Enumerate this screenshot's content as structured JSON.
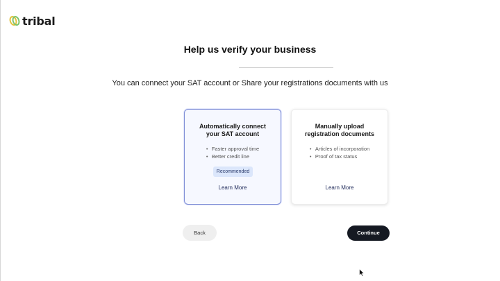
{
  "brand": {
    "name": "tribal"
  },
  "page": {
    "title": "Help us verify your business",
    "subtitle": "You can connect your SAT account or Share your registrations documents with us"
  },
  "cards": [
    {
      "title_line1": "Automatically connect",
      "title_line2": "your SAT account",
      "bullets": [
        "Faster approval time",
        "Better credit line"
      ],
      "badge": "Recommended",
      "link": "Learn More",
      "selected": true
    },
    {
      "title_line1": "Manually upload",
      "title_line2": "registration documents",
      "bullets": [
        "Articles of incorporation",
        "Proof of tax status"
      ],
      "link": "Learn More",
      "selected": false
    }
  ],
  "actions": {
    "back_label": "Back",
    "continue_label": "Continue"
  },
  "colors": {
    "accent_border": "#7f8ed6",
    "badge_bg": "#dbe6fb",
    "primary_button": "#151922",
    "logo_yellow": "#e3c23a",
    "logo_green": "#7dc36b"
  },
  "icons": {
    "logo": "tribal-logo-icon",
    "cursor": "mouse-pointer-icon"
  }
}
